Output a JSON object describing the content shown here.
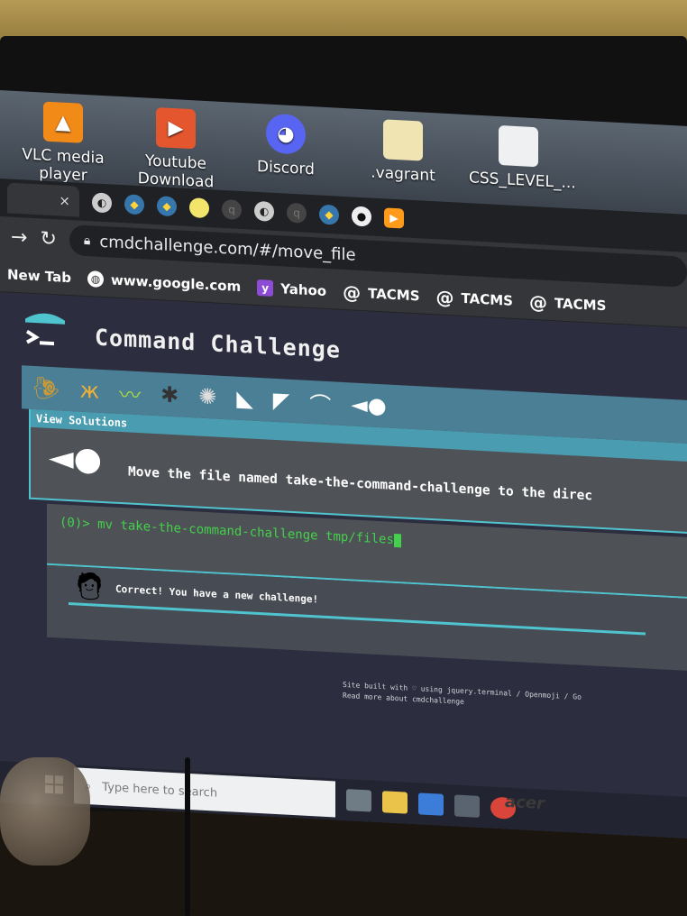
{
  "desktop": {
    "icons": [
      {
        "label": "VLC media player",
        "icon": "vlc-cone-icon",
        "color": "#f28a18"
      },
      {
        "label": "Youtube Download",
        "icon": "youtube-downloader-icon",
        "color": "#e4572e"
      },
      {
        "label": "Discord",
        "icon": "discord-icon",
        "color": "#5865f2"
      },
      {
        "label": ".vagrant",
        "icon": "file-icon",
        "color": "#f1e4b3"
      },
      {
        "label": "CSS_LEVEL_...",
        "icon": "file-icon",
        "color": "#eef0f2"
      }
    ]
  },
  "browser": {
    "tab_close": "×",
    "tabs": [
      "chrome-tab",
      "python-tab",
      "python-tab",
      "yellow-dot-tab",
      "qix-tab",
      "chrome-tab",
      "qix-tab",
      "python-tab",
      "github-tab",
      "youtube-tab"
    ],
    "url": "cmdchallenge.com/#/move_file",
    "bookmarks": [
      {
        "label": "New Tab",
        "icon": "none"
      },
      {
        "label": "www.google.com",
        "icon": "globe-icon"
      },
      {
        "label": "Yahoo",
        "icon": "yahoo-icon"
      },
      {
        "label": "TACMS",
        "icon": "at-icon"
      },
      {
        "label": "TACMS",
        "icon": "at-icon"
      },
      {
        "label": "TACMS",
        "icon": "at-icon"
      }
    ]
  },
  "page": {
    "title": "Command Challenge",
    "levels": [
      "snail",
      "butterfly",
      "caterpillar",
      "ant",
      "web",
      "whale",
      "shark",
      "dolphin",
      "fish"
    ],
    "view_solutions": "View Solutions",
    "task": "Move the file named take-the-command-challenge to the direc",
    "terminal": {
      "prompt": "(0)>",
      "command": "mv take-the-command-challenge tmp/files"
    },
    "result": "Correct! You have a new challenge!",
    "footer_line1": "Site built with ♡ using jquery.terminal / Openmoji / Go",
    "footer_line2": "Read more about cmdchallenge"
  },
  "taskbar": {
    "search_placeholder": "Type here to search"
  },
  "monitor": {
    "brand": "acer"
  },
  "colors": {
    "accent": "#4fc4cf",
    "terminal_green": "#43d04a",
    "page_bg": "#2c2e3f"
  }
}
